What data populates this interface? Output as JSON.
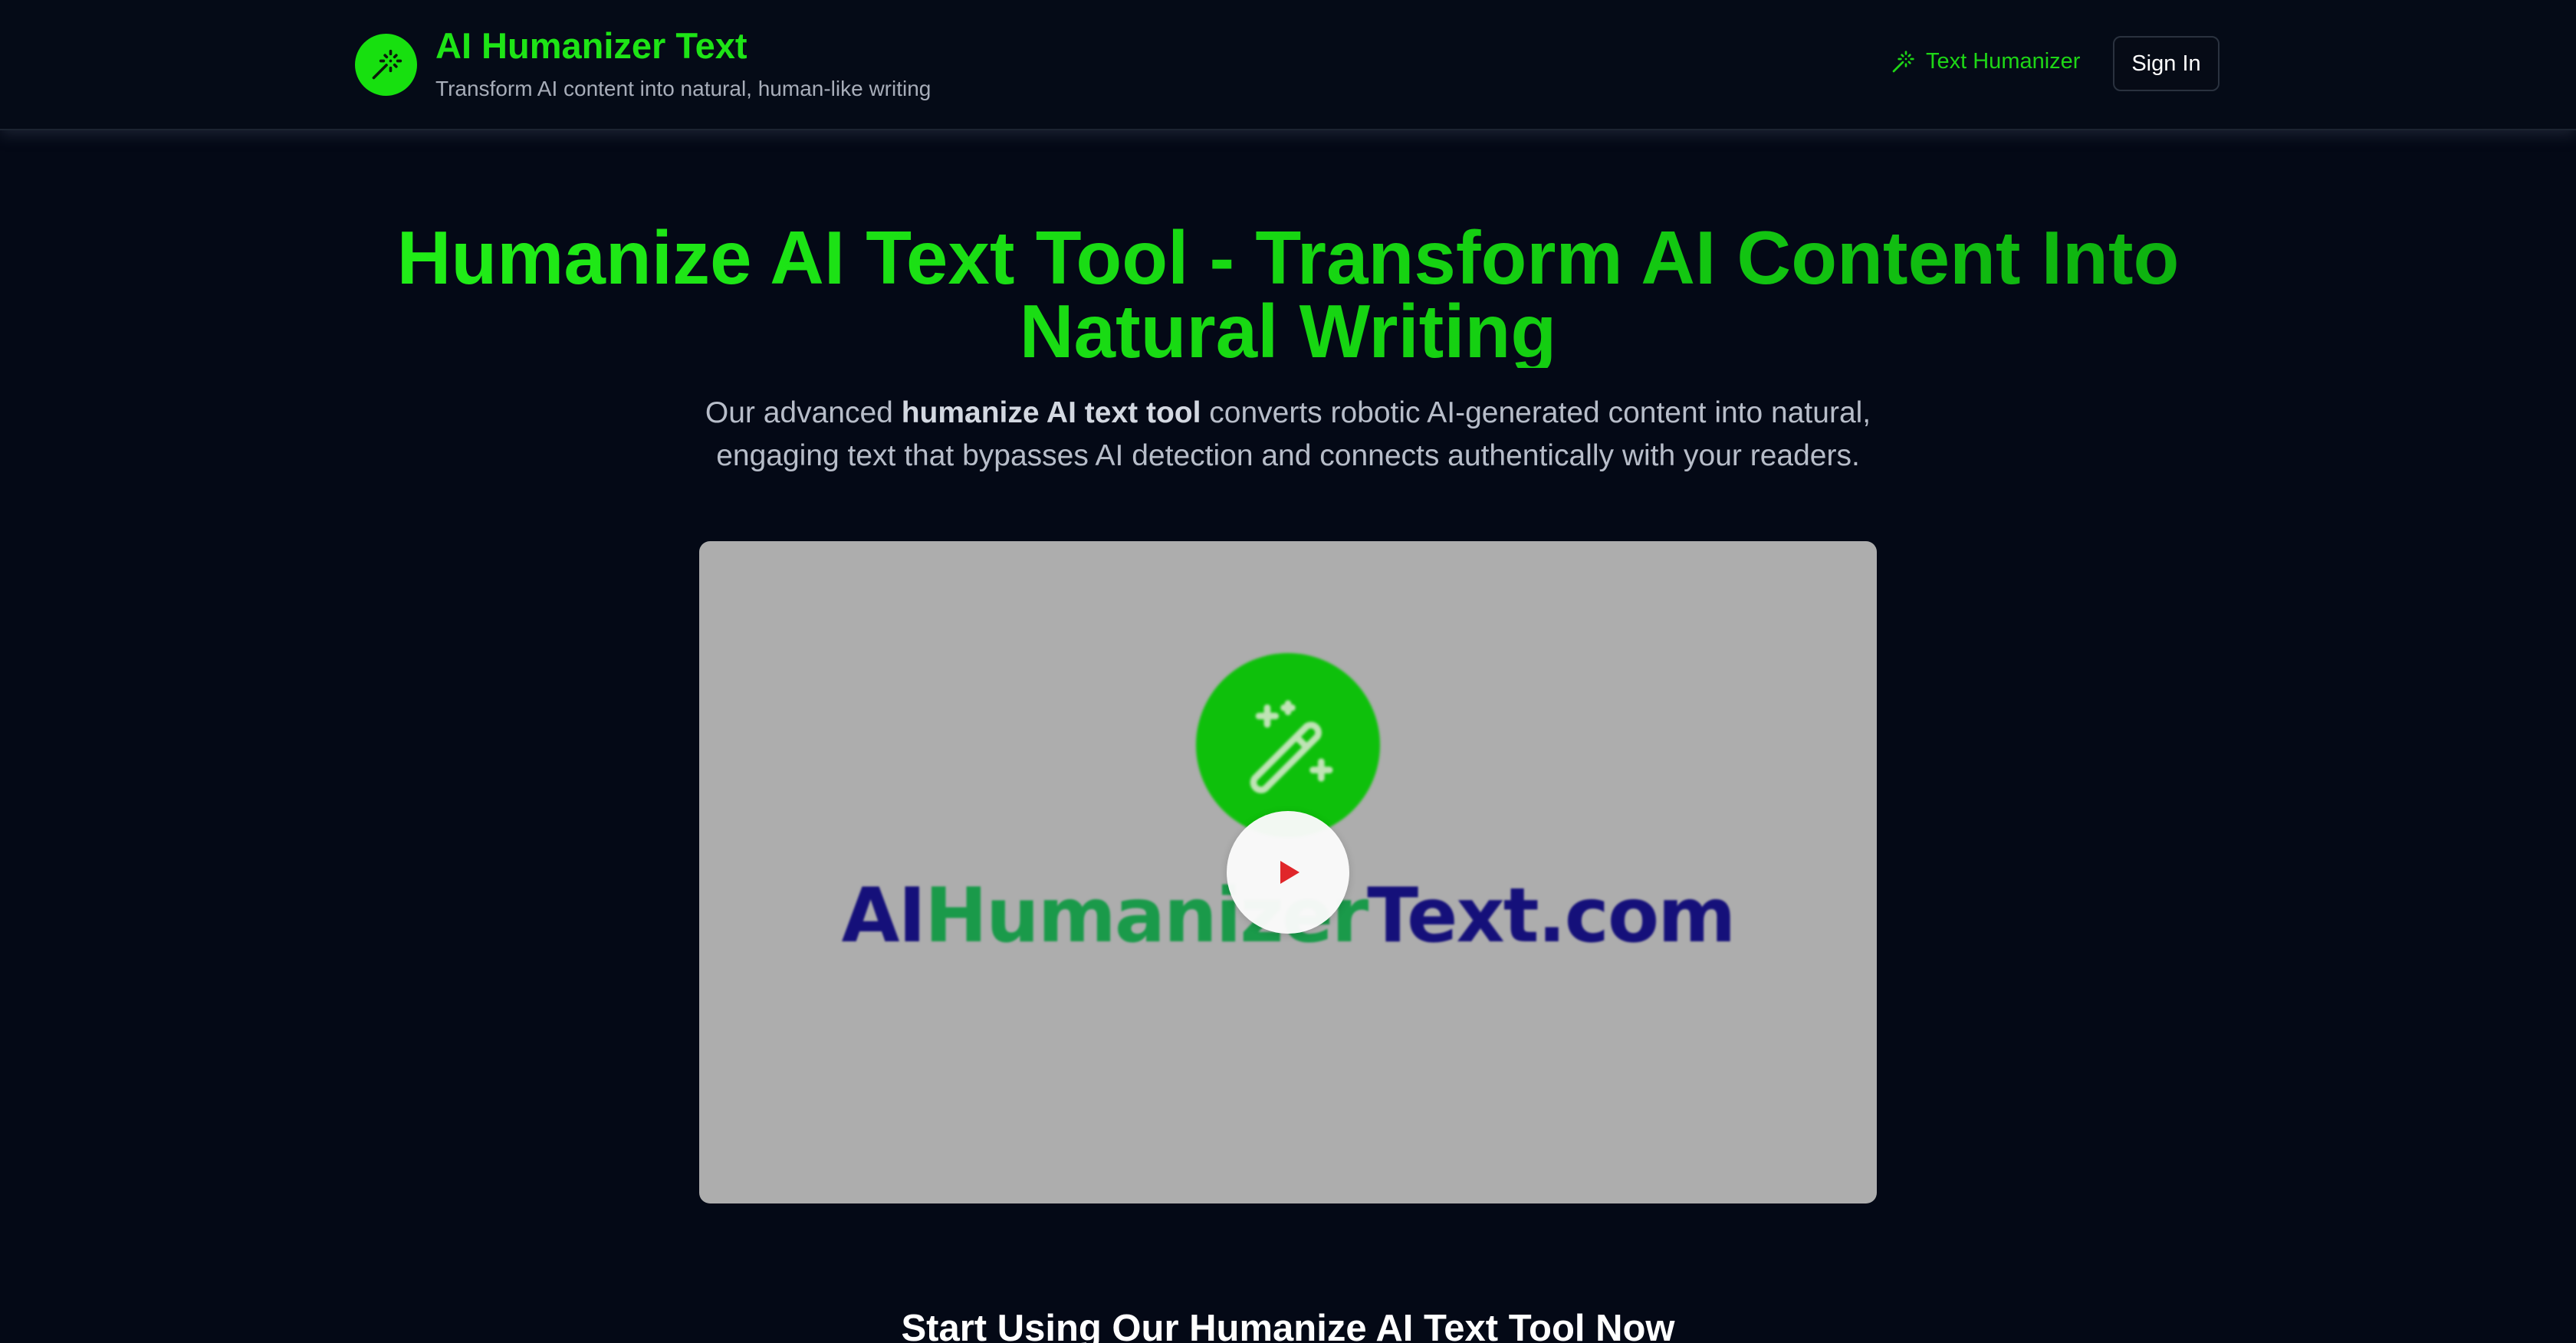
{
  "header": {
    "brand_title": "AI Humanizer Text",
    "brand_subtitle": "Transform AI content into natural, human-like writing",
    "nav_link": "Text Humanizer",
    "sign_in": "Sign In",
    "logo_icon": "magic-wand-icon"
  },
  "hero": {
    "title": "Humanize AI Text Tool - Transform AI Content Into Natural Writing",
    "desc_prefix": "Our advanced ",
    "desc_bold": "humanize AI text tool",
    "desc_suffix": " converts robotic AI-generated content into natural, engaging text that bypasses AI detection and connects authentically with your readers."
  },
  "video": {
    "wordmark_part1": "AI",
    "wordmark_part2": "Humanizer",
    "wordmark_part3": "Text.com",
    "play_icon": "play-icon"
  },
  "cta": {
    "heading": "Start Using Our Humanize AI Text Tool Now"
  },
  "colors": {
    "background": "#040916",
    "accent_green": "#1ee416",
    "wordmark_navy": "#15107a",
    "wordmark_green": "#1a9a4a",
    "play_red": "#e0262a"
  }
}
